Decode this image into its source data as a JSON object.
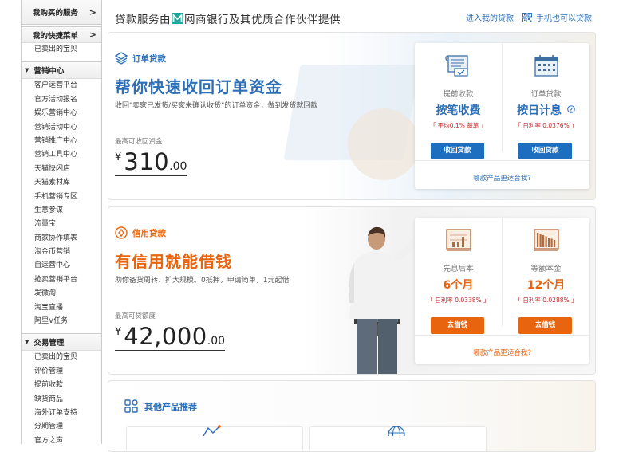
{
  "sidebar": {
    "bought": "我购买的服务",
    "quick_menu": "我的快捷菜单",
    "quick_items": [
      "已卖出的宝贝"
    ],
    "marketing_title": "营销中心",
    "marketing_items": [
      "客户运营平台",
      "官方活动报名",
      "娱乐营销中心",
      "营销活动中心",
      "营销推广中心",
      "营销工具中心",
      "天猫快闪店",
      "天猫素材库",
      "手机营销专区",
      "生意参谋",
      "流量宝",
      "商家协作填表",
      "淘金币营销",
      "自运营中心",
      "抢卖营销平台",
      "发微淘",
      "淘宝直播",
      "阿里V任务"
    ],
    "trade_title": "交易管理",
    "trade_items": [
      "已卖出的宝贝",
      "评价管理",
      "提前收款",
      "缺货商品",
      "海外订单支持",
      "分期管理",
      "官方之声"
    ]
  },
  "header": {
    "title_pre": "贷款服务由",
    "title_post": "网商银行及其优质合作伙伴提供",
    "link_my_loans": "进入我的贷款",
    "link_mobile": "手机也可以贷款"
  },
  "order_loan": {
    "tag": "订单贷款",
    "headline": "帮你快速收回订单资金",
    "desc": "收回\"卖家已发货/买家未确认收货\"的订单资金，做到发货就回款",
    "cap": "最高可收回资金",
    "currency": "¥",
    "amount_int": "310",
    "amount_dec": ".00",
    "products": [
      {
        "name": "提前收款",
        "big": "按笔收费",
        "rate": "「 平均0.1% 每笔 」",
        "btn": "收回贷款"
      },
      {
        "name": "订单贷款",
        "big": "按日计息",
        "rate": "「 日利率 0.0376% 」",
        "btn": "收回贷款"
      }
    ],
    "which": "哪款产品更适合我?"
  },
  "credit_loan": {
    "tag": "信用贷款",
    "headline": "有信用就能借钱",
    "desc": "助你备货周转、扩大规模。0抵押，申请简单，1元起借",
    "cap": "最高可贷额度",
    "currency": "¥",
    "amount_int": "42,000",
    "amount_dec": ".00",
    "products": [
      {
        "name": "先息后本",
        "big": "6个月",
        "rate": "「 日利率 0.0338% 」",
        "btn": "去借钱"
      },
      {
        "name": "等额本金",
        "big": "12个月",
        "rate": "「 日利率 0.0288% 」",
        "btn": "去借钱"
      }
    ],
    "which": "哪款产品更适合我?"
  },
  "other": {
    "title": "其他产品推荐"
  },
  "colors": {
    "blue": "#2c6fb7",
    "orange": "#e9640f",
    "rate_red": "#c62828"
  }
}
